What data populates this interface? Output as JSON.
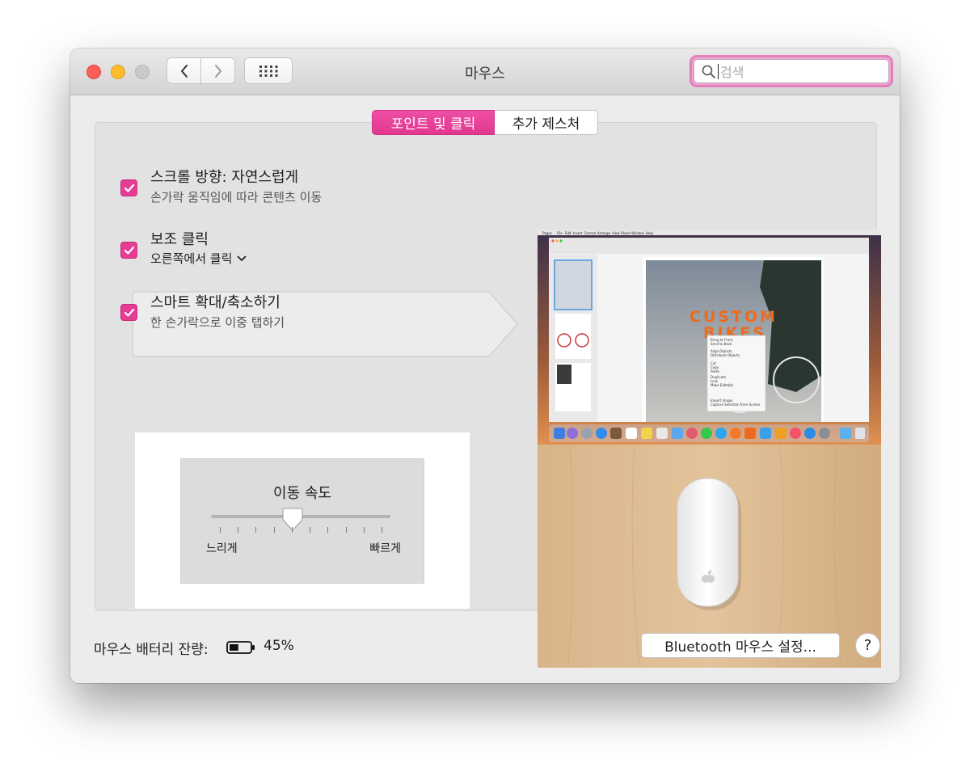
{
  "window": {
    "title": "마우스"
  },
  "search": {
    "placeholder": "검색",
    "value": ""
  },
  "tabs": [
    {
      "label": "포인트 및 클릭",
      "active": true
    },
    {
      "label": "추가 제스처",
      "active": false
    }
  ],
  "options": [
    {
      "title": "스크롤 방향: 자연스럽게",
      "subtitle": "손가락 움직임에 따라 콘텐츠 이동",
      "checked": true
    },
    {
      "title": "보조 클릭",
      "subtitle": "오른쪽에서 클릭",
      "checked": true,
      "has_dropdown": true
    },
    {
      "title": "스마트 확대/축소하기",
      "subtitle": "한 손가락으로 이중 탭하기",
      "checked": true
    }
  ],
  "tracking_speed": {
    "label": "이동 속도",
    "min_label": "느리게",
    "max_label": "빠르게",
    "ticks": 10,
    "value_fraction": 0.45
  },
  "preview": {
    "menu_bar_items": [
      "Pages",
      "File",
      "Edit",
      "Insert",
      "Format",
      "Arrange",
      "View",
      "Share",
      "Window",
      "Help"
    ],
    "doc_heading": "CUSTOM",
    "doc_heading2": "BIKES",
    "context_menu": [
      "Bring to Front",
      "Send to Back",
      "Align Objects",
      "Distribute Objects",
      "Cut",
      "Copy",
      "Paste",
      "Duplicate",
      "Lock",
      "Make Editable",
      "Import Image",
      "Capture Selection from Screen"
    ]
  },
  "footer": {
    "battery_label": "마우스 배터리 잔량:",
    "battery_percent": "45%",
    "battery_level": 0.45,
    "bluetooth_button": "Bluetooth 마우스 설정...",
    "help_button": "?"
  },
  "colors": {
    "accent": "#e53c94",
    "search_focus": "#e57fbc",
    "close": "#fc5f57",
    "minimize": "#fdbc2e",
    "zoom_disabled": "#c9c9c9"
  }
}
